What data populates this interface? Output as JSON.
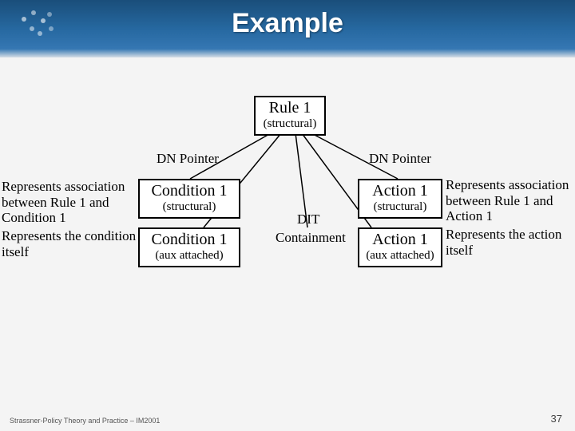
{
  "title": "Example",
  "rule": {
    "name": "Rule 1",
    "sub": "(structural)"
  },
  "dn_left": "DN Pointer",
  "dn_right": "DN Pointer",
  "dit": "DIT",
  "containment": "Containment",
  "cond_s": {
    "name": "Condition 1",
    "sub": "(structural)"
  },
  "cond_a": {
    "name": "Condition 1",
    "sub": "(aux attached)"
  },
  "act_s": {
    "name": "Action 1",
    "sub": "(structural)"
  },
  "act_a": {
    "name": "Action 1",
    "sub": "(aux attached)"
  },
  "note_l1": "Represents association between Rule 1 and Condition 1",
  "note_l2": "Represents the condition itself",
  "note_r1": "Represents association between Rule 1 and Action 1",
  "note_r2": "Represents the action itself",
  "footer": "Strassner-Policy Theory and Practice – IM2001",
  "pagenum": "37"
}
